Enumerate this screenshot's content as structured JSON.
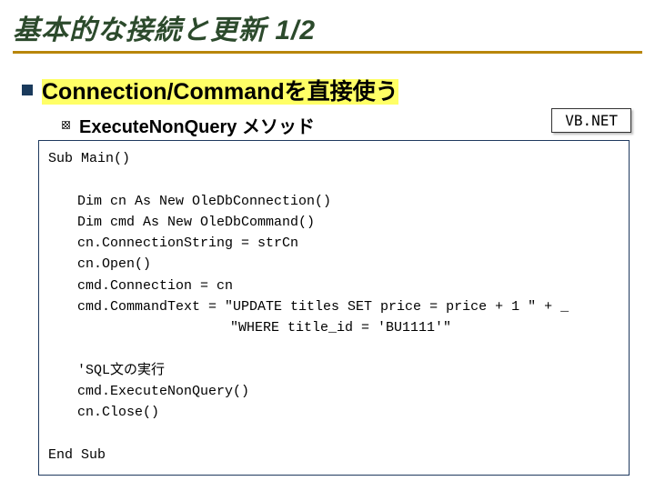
{
  "title": "基本的な接続と更新 1/2",
  "bullet": {
    "pre": "Connection/Command",
    "post": "を直接使う"
  },
  "sub": "ExecuteNonQuery メソッド",
  "badge": "VB.NET",
  "code": {
    "l0": "Sub Main()",
    "l1": "Dim cn As New OleDbConnection()",
    "l2": "Dim cmd As New OleDbCommand()",
    "l3": "cn.ConnectionString = strCn",
    "l4": "cn.Open()",
    "l5": "cmd.Connection = cn",
    "l6": "cmd.CommandText = \"UPDATE titles SET price = price + 1 \" + _",
    "l7": "\"WHERE title_id = 'BU1111'\"",
    "l8": "'SQL文の実行",
    "l9": "cmd.ExecuteNonQuery()",
    "l10": "cn.Close()",
    "l11": "End Sub"
  }
}
